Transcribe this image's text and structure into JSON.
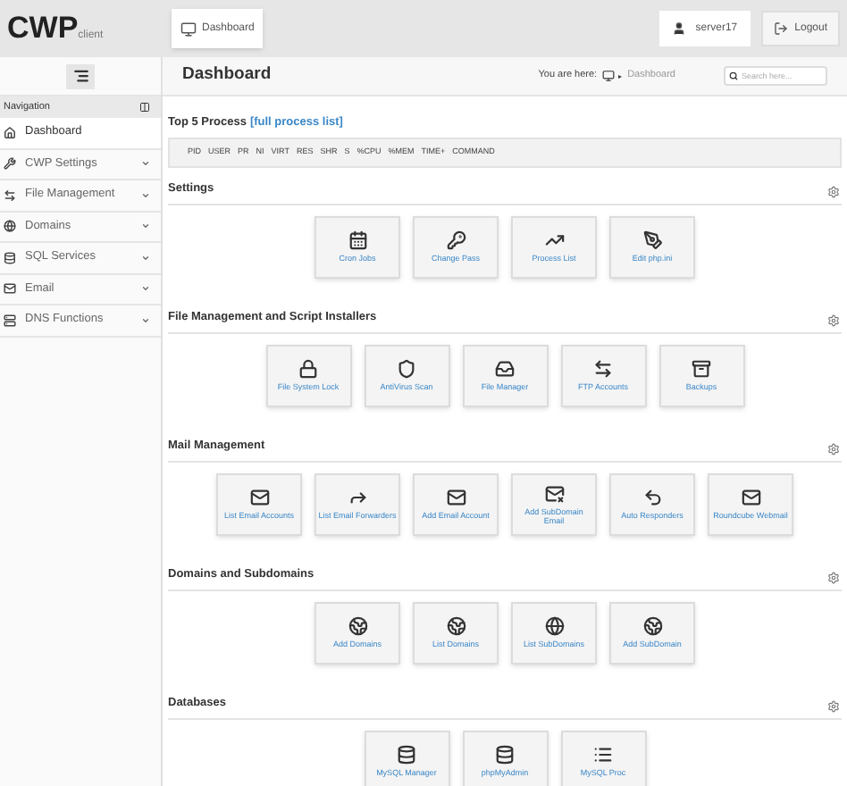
{
  "logo": {
    "main": "CWP",
    "sub": "client"
  },
  "top_tab": {
    "label": "Dashboard"
  },
  "user": {
    "name": "server17"
  },
  "logout": {
    "label": "Logout"
  },
  "sidebar": {
    "title": "Navigation",
    "items": [
      {
        "label": "Dashboard",
        "has_caret": false,
        "selected": true
      },
      {
        "label": "CWP Settings",
        "has_caret": true,
        "selected": false
      },
      {
        "label": "File Management",
        "has_caret": true,
        "selected": false
      },
      {
        "label": "Domains",
        "has_caret": true,
        "selected": false
      },
      {
        "label": "SQL Services",
        "has_caret": true,
        "selected": false
      },
      {
        "label": "Email",
        "has_caret": true,
        "selected": false
      },
      {
        "label": "DNS Functions",
        "has_caret": true,
        "selected": false
      }
    ]
  },
  "page": {
    "title": "Dashboard",
    "breadcrumb_label": "You are here:",
    "breadcrumb_sep": "▸",
    "breadcrumb_current": "Dashboard",
    "search_placeholder": "Search here..."
  },
  "process": {
    "title": "Top 5 Process",
    "link": "[full process list]",
    "columns": [
      "PID",
      "USER",
      "PR",
      "NI",
      "VIRT",
      "RES",
      "SHR",
      "S",
      "%CPU",
      "%MEM",
      "TIME+",
      "COMMAND"
    ]
  },
  "sections": [
    {
      "title": "Settings",
      "tiles": [
        {
          "label": "Cron Jobs"
        },
        {
          "label": "Change Pass"
        },
        {
          "label": "Process List"
        },
        {
          "label": "Edit php.ini"
        }
      ]
    },
    {
      "title": "File Management and Script Installers",
      "tiles": [
        {
          "label": "File System Lock"
        },
        {
          "label": "AntiVirus Scan"
        },
        {
          "label": "File Manager"
        },
        {
          "label": "FTP Accounts"
        },
        {
          "label": "Backups"
        }
      ]
    },
    {
      "title": "Mail Management",
      "tiles": [
        {
          "label": "List Email Accounts"
        },
        {
          "label": "List Email Forwarders"
        },
        {
          "label": "Add Email Account"
        },
        {
          "label": "Add SubDomain Email"
        },
        {
          "label": "Auto Responders"
        },
        {
          "label": "Roundcube Webmail"
        }
      ]
    },
    {
      "title": "Domains and Subdomains",
      "tiles": [
        {
          "label": "Add Domains"
        },
        {
          "label": "List Domains"
        },
        {
          "label": "List SubDomains"
        },
        {
          "label": "Add SubDomain"
        }
      ]
    },
    {
      "title": "Databases",
      "tiles": [
        {
          "label": "MySQL Manager"
        },
        {
          "label": "phpMyAdmin"
        },
        {
          "label": "MySQL Proc"
        }
      ]
    }
  ]
}
